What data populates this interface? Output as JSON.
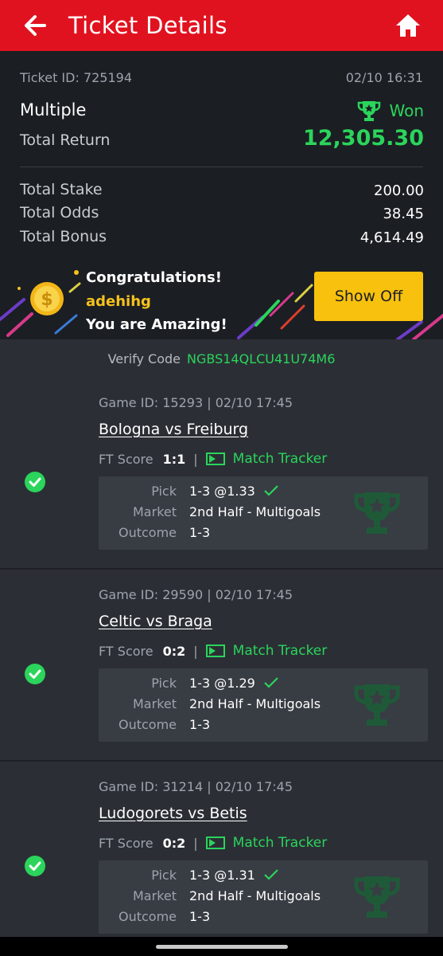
{
  "header": {
    "title": "Ticket Details",
    "back_icon": "arrow-left-icon",
    "home_icon": "home-icon"
  },
  "summary": {
    "ticket_id": "Ticket ID: 725194",
    "date": "02/10 16:31",
    "bet_type": "Multiple",
    "status": "Won",
    "return_label": "Total Return",
    "return_value": "12,305.30",
    "stake_label": "Total Stake",
    "stake_value": "200.00",
    "odds_label": "Total Odds",
    "odds_value": "38.45",
    "bonus_label": "Total Bonus",
    "bonus_value": "4,614.49"
  },
  "banner": {
    "congrats": "Congratulations!",
    "username": "adehihg",
    "amazing": "You are Amazing!",
    "button": "Show Off"
  },
  "verify": {
    "label": "Verify Code",
    "code": "NGBS14QLCU41U74M6"
  },
  "labels": {
    "ft_score": "FT Score",
    "tracker": "Match Tracker",
    "pick": "Pick",
    "market": "Market",
    "outcome": "Outcome",
    "separator": "|"
  },
  "games": [
    {
      "game_id": "Game ID: 15293 | 02/10 17:45",
      "teams": "Bologna vs Freiburg",
      "score": "1:1",
      "pick": "1-3 @1.33",
      "market": "2nd Half - Multigoals",
      "outcome": "1-3"
    },
    {
      "game_id": "Game ID: 29590 | 02/10 17:45",
      "teams": "Celtic vs Braga",
      "score": "0:2",
      "pick": "1-3 @1.29",
      "market": "2nd Half - Multigoals",
      "outcome": "1-3"
    },
    {
      "game_id": "Game ID: 31214 | 02/10 17:45",
      "teams": "Ludogorets vs Betis",
      "score": "0:2",
      "pick": "1-3 @1.31",
      "market": "2nd Half - Multigoals",
      "outcome": "1-3"
    }
  ],
  "colors": {
    "header": "#e1121f",
    "accent_green": "#2bd45b",
    "button_yellow": "#f7c10e",
    "background": "#1e2025"
  }
}
